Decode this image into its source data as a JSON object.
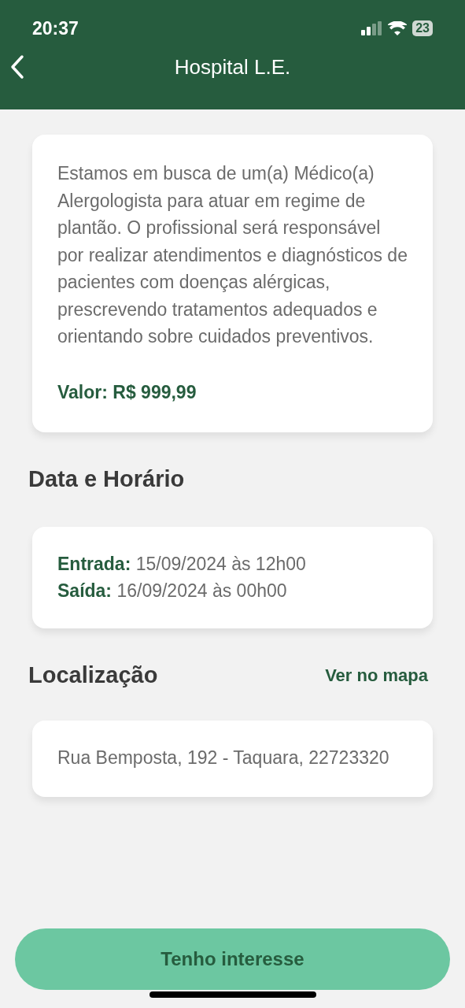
{
  "status_bar": {
    "time": "20:37",
    "battery": "23"
  },
  "header": {
    "title": "Hospital L.E."
  },
  "description": {
    "text": "Estamos em busca de um(a) Médico(a) Alergologista para atuar em regime de plantão. O profissional será responsável por realizar atendimentos e diagnósticos de pacientes com doenças alérgicas, prescrevendo tratamentos adequados e orientando sobre cuidados preventivos.",
    "price": "Valor: R$ 999,99"
  },
  "schedule": {
    "heading": "Data e Horário",
    "rows": [
      {
        "label": "Entrada:",
        "value": "15/09/2024 às 12h00"
      },
      {
        "label": "Saída:",
        "value": "16/09/2024 às 00h00"
      }
    ]
  },
  "location": {
    "heading": "Localização",
    "map_link": "Ver no mapa",
    "address": "Rua Bemposta, 192 - Taquara, 22723320"
  },
  "action_button": "Tenho interesse"
}
